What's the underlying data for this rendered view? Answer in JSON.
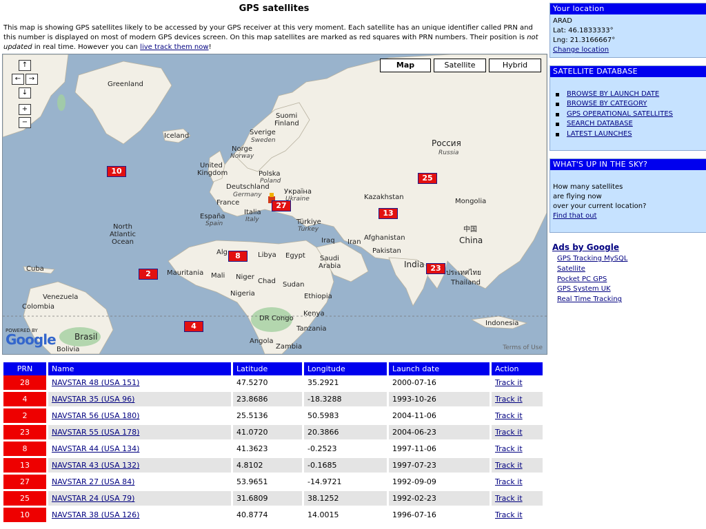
{
  "page": {
    "title": "GPS satellites",
    "intro_1": "This map is showing GPS satellites likely to be accessed by your GPS receiver at this very moment. Each satellite has an unique identifier called PRN and this number is displayed on most of modern GPS devices screen. On this map satellites are marked as red squares with PRN numbers. Their position is ",
    "intro_em": "not updated",
    "intro_2": " in real time. However you can ",
    "intro_link": "live track them now",
    "intro_end": "!"
  },
  "map": {
    "types": [
      "Map",
      "Satellite",
      "Hybrid"
    ],
    "active_type": "Map",
    "powered_by": "POWERED BY",
    "logo": "Google",
    "terms": "Terms of Use",
    "nav": {
      "up": "↑",
      "left": "←",
      "right": "→",
      "down": "↓",
      "zoom_in": "+",
      "zoom_out": "−"
    },
    "labels": {
      "greenland": "Greenland",
      "iceland": "Iceland",
      "suomi": "Suomi",
      "finland": "Finland",
      "sverige": "Sverige",
      "sweden": "Sweden",
      "norge": "Norge",
      "norway": "Norway",
      "uk": "United",
      "uk2": "Kingdom",
      "polska": "Polska",
      "poland": "Poland",
      "deutschland": "Deutschland",
      "germany": "Germany",
      "ukraina": "Україна",
      "ukraine": "Ukraine",
      "france": "France",
      "espana": "España",
      "spain": "Spain",
      "italia": "Italia",
      "italy": "Italy",
      "turkiye": "Türkiye",
      "turkey": "Turkey",
      "russia_ru": "Россия",
      "russia": "Russia",
      "kazakhstan": "Kazakhstan",
      "mongolia": "Mongolia",
      "china_zh": "中国",
      "china": "China",
      "atlantic1": "North",
      "atlantic2": "Atlantic",
      "atlantic3": "Ocean",
      "algeria": "Alg",
      "libya": "Libya",
      "egypt": "Egypt",
      "iraq": "Iraq",
      "iran": "Iran",
      "afghanistan": "Afghanistan",
      "pakistan": "Pakistan",
      "india": "India",
      "saudi1": "Saudi",
      "saudi2": "Arabia",
      "thai_th": "ประเทศไทย",
      "thailand": "Thailand",
      "cuba": "Cuba",
      "mauritania": "Mauritania",
      "mali": "Mali",
      "niger": "Niger",
      "chad": "Chad",
      "sudan": "Sudan",
      "nigeria": "Nigeria",
      "ethiopia": "Ethiopia",
      "venezuela": "Venezuela",
      "colombia": "Colombia",
      "kenya": "Kenya",
      "drc": "DR Congo",
      "tanzania": "Tanzania",
      "indonesia": "Indonesia",
      "brasil": "Brasil",
      "bolivia": "Bolivia",
      "angola": "Angola",
      "zambia": "Zambia"
    },
    "markers": [
      "10",
      "25",
      "27",
      "13",
      "8",
      "2",
      "23",
      "4"
    ]
  },
  "table": {
    "headers": [
      "PRN",
      "Name",
      "Latitude",
      "Longitude",
      "Launch date",
      "Action"
    ],
    "rows": [
      {
        "prn": "28",
        "name": "NAVSTAR 48 (USA 151)",
        "lat": "47.5270",
        "lng": "35.2921",
        "date": "2000-07-16",
        "action": "Track it"
      },
      {
        "prn": "4",
        "name": "NAVSTAR 35 (USA 96)",
        "lat": "23.8686",
        "lng": "-18.3288",
        "date": "1993-10-26",
        "action": "Track it"
      },
      {
        "prn": "2",
        "name": "NAVSTAR 56 (USA 180)",
        "lat": "25.5136",
        "lng": "50.5983",
        "date": "2004-11-06",
        "action": "Track it"
      },
      {
        "prn": "23",
        "name": "NAVSTAR 55 (USA 178)",
        "lat": "41.0720",
        "lng": "20.3866",
        "date": "2004-06-23",
        "action": "Track it"
      },
      {
        "prn": "8",
        "name": "NAVSTAR 44 (USA 134)",
        "lat": "41.3623",
        "lng": "-0.2523",
        "date": "1997-11-06",
        "action": "Track it"
      },
      {
        "prn": "13",
        "name": "NAVSTAR 43 (USA 132)",
        "lat": "4.8102",
        "lng": "-0.1685",
        "date": "1997-07-23",
        "action": "Track it"
      },
      {
        "prn": "27",
        "name": "NAVSTAR 27 (USA 84)",
        "lat": "53.9651",
        "lng": "-14.9721",
        "date": "1992-09-09",
        "action": "Track it"
      },
      {
        "prn": "25",
        "name": "NAVSTAR 24 (USA 79)",
        "lat": "31.6809",
        "lng": "38.1252",
        "date": "1992-02-23",
        "action": "Track it"
      },
      {
        "prn": "10",
        "name": "NAVSTAR 38 (USA 126)",
        "lat": "40.8774",
        "lng": "14.0015",
        "date": "1996-07-16",
        "action": "Track it"
      }
    ]
  },
  "sidebar": {
    "location": {
      "title": "Your location",
      "city": "ARAD",
      "lat": "Lat: 46.1833333°",
      "lng": "Lng: 21.3166667°",
      "change": "Change location"
    },
    "database": {
      "title": "SATELLITE DATABASE",
      "items": [
        "BROWSE BY LAUNCH DATE",
        "BROWSE BY CATEGORY",
        "GPS OPERATIONAL SATELLITES",
        "SEARCH DATABASE",
        "LATEST LAUNCHES"
      ]
    },
    "sky": {
      "title": "WHAT'S UP IN THE SKY?",
      "line1": "How many satellites",
      "line2": "are flying now",
      "line3": "over your current location?",
      "link": "Find that out"
    },
    "ads": {
      "title": "Ads by Google",
      "items": [
        "GPS Tracking MySQL",
        "Satellite",
        "Pocket PC GPS",
        "GPS System UK",
        "Real Time Tracking"
      ]
    }
  },
  "colors": {
    "header_blue": "#0000ee",
    "marker_red": "#e21010",
    "sidebar_bg": "#c6e2ff",
    "ocean": "#99b3cc",
    "land": "#f2efe6"
  }
}
